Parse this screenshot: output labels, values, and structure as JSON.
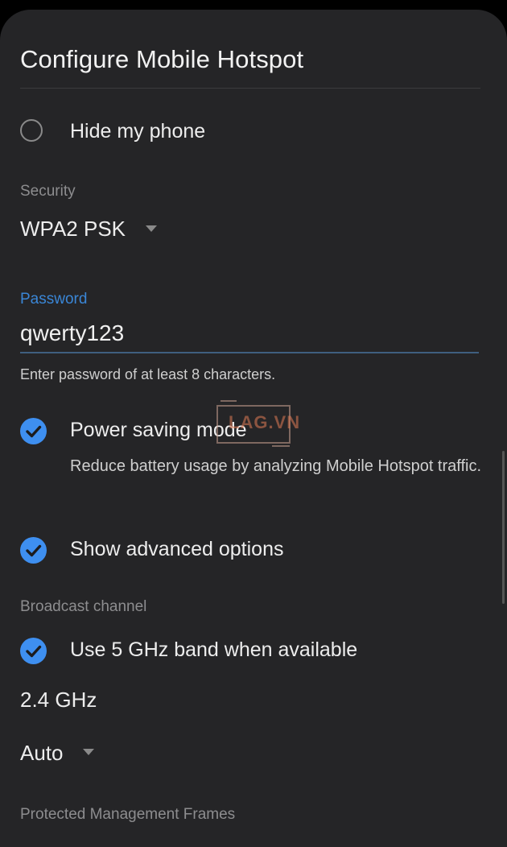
{
  "dialog": {
    "title": "Configure Mobile Hotspot"
  },
  "hide_phone": {
    "label": "Hide my phone",
    "checked": false
  },
  "security": {
    "section_label": "Security",
    "selected": "WPA2 PSK"
  },
  "password": {
    "label": "Password",
    "value": "qwerty123",
    "helper": "Enter password of at least 8 characters."
  },
  "power_saving": {
    "label": "Power saving mode",
    "description": "Reduce battery usage by analyzing Mobile Hotspot traffic.",
    "checked": true
  },
  "advanced": {
    "label": "Show advanced options",
    "checked": true
  },
  "broadcast": {
    "section_label": "Broadcast channel",
    "use_5ghz_label": "Use 5 GHz band when available",
    "use_5ghz_checked": true,
    "band": "2.4 GHz",
    "channel_selected": "Auto"
  },
  "pmf": {
    "section_label": "Protected Management Frames"
  },
  "watermark": {
    "text": "LAG.VN"
  },
  "colors": {
    "background": "#252527",
    "accent": "#3e8ff0",
    "password_label": "#3a86d6",
    "secondary_text": "#8d8d8f"
  }
}
